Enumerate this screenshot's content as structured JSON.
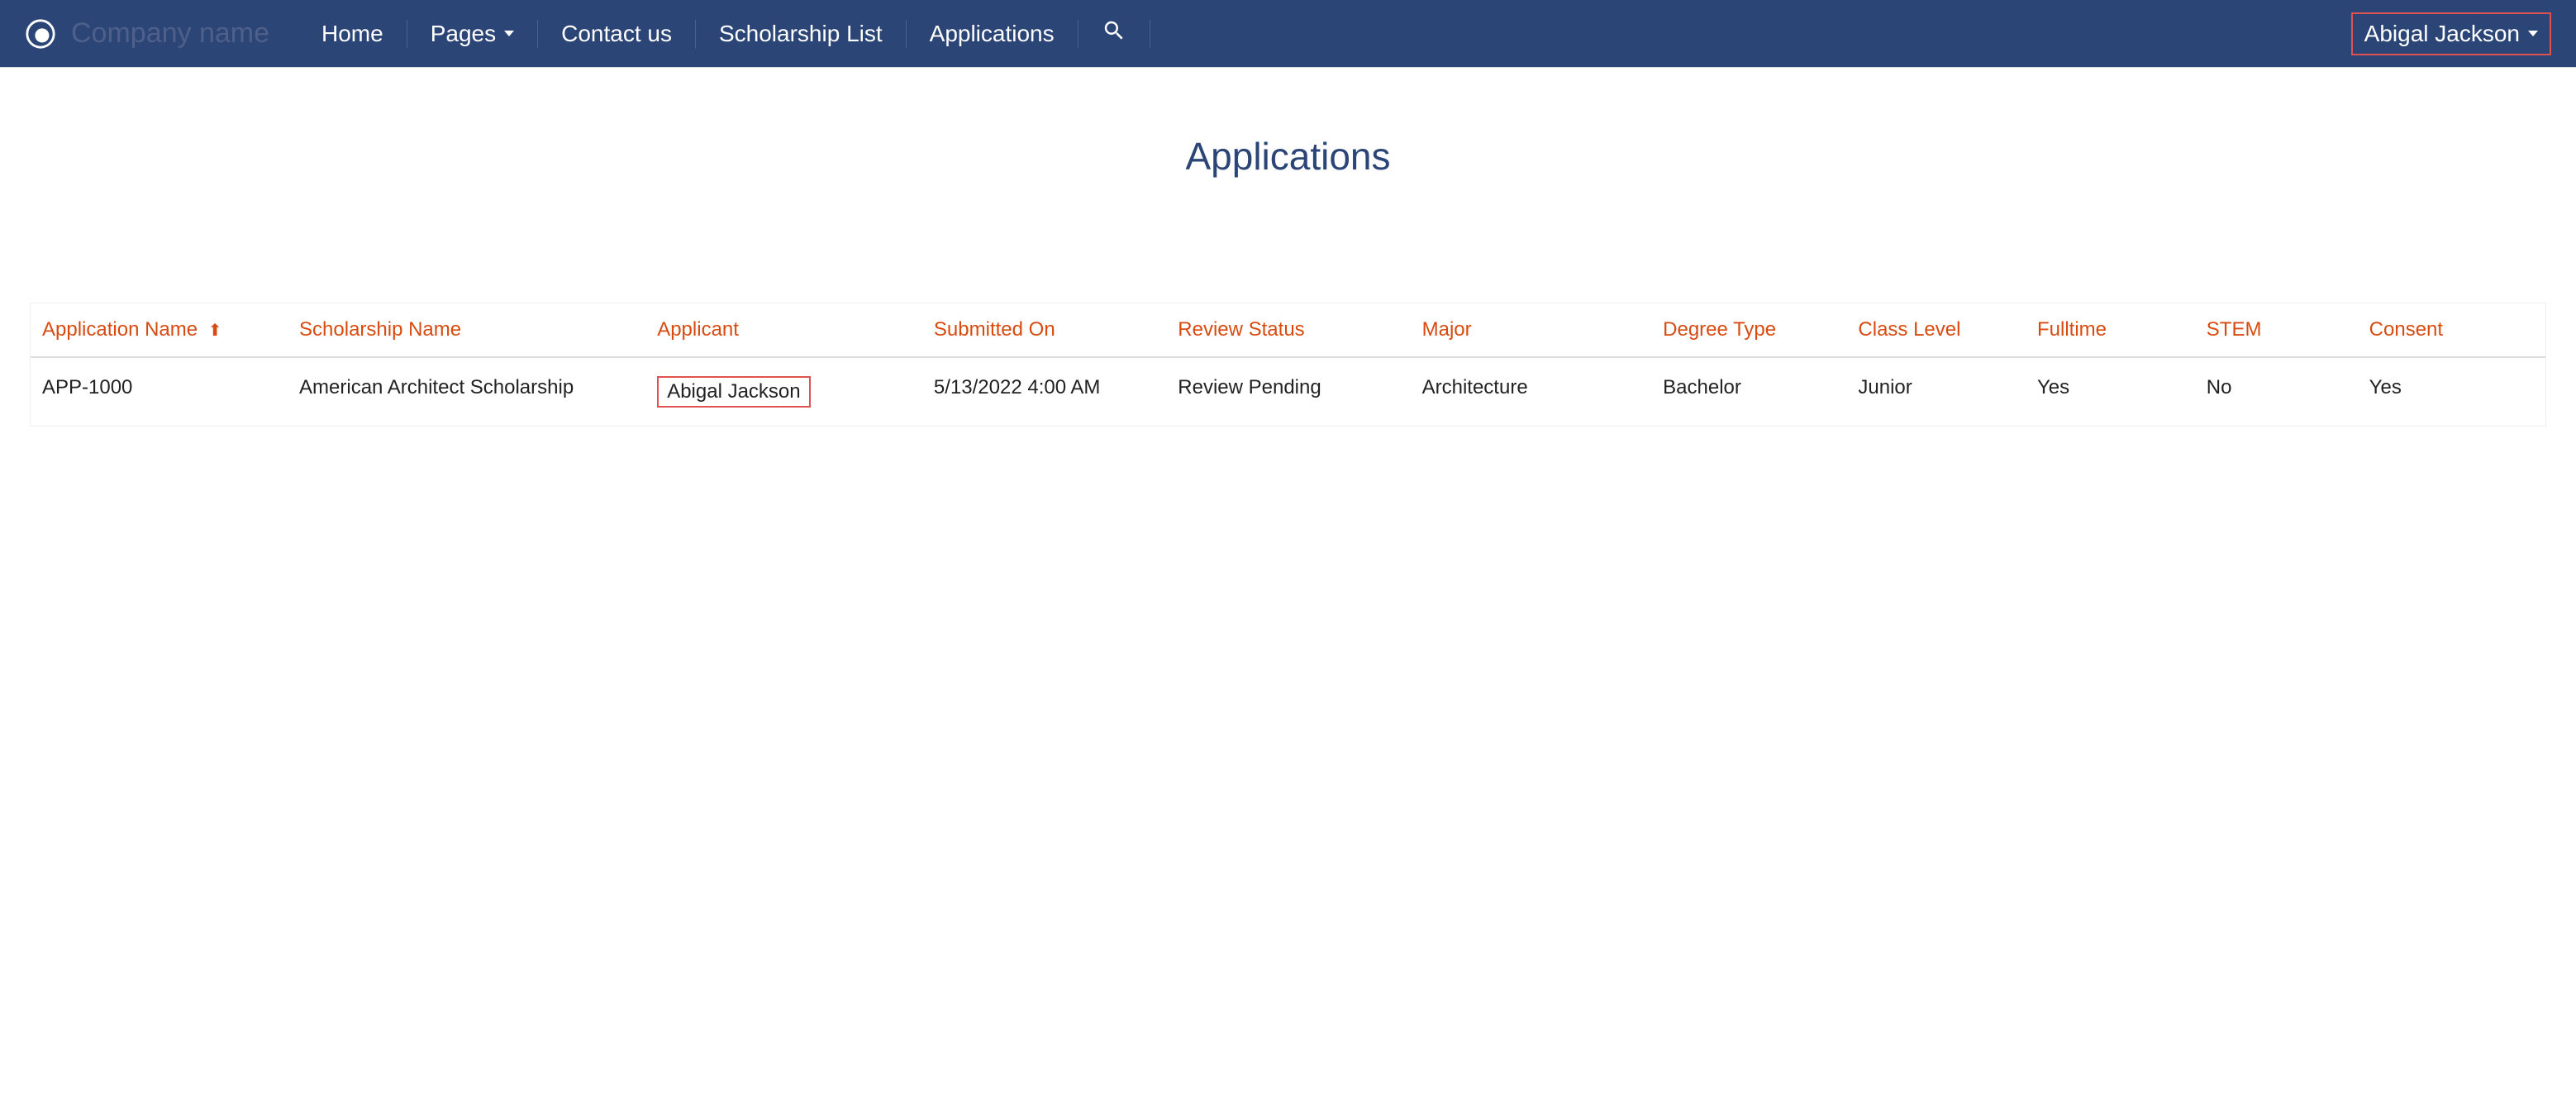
{
  "header": {
    "company_name": "Company name",
    "nav": {
      "home": "Home",
      "pages": "Pages",
      "contact": "Contact us",
      "scholarship_list": "Scholarship List",
      "applications": "Applications"
    },
    "user_name": "Abigal Jackson"
  },
  "page": {
    "title": "Applications"
  },
  "table": {
    "columns": {
      "application_name": "Application Name",
      "scholarship_name": "Scholarship Name",
      "applicant": "Applicant",
      "submitted_on": "Submitted On",
      "review_status": "Review Status",
      "major": "Major",
      "degree_type": "Degree Type",
      "class_level": "Class Level",
      "fulltime": "Fulltime",
      "stem": "STEM",
      "consent": "Consent"
    },
    "sort": {
      "column": "application_name",
      "direction": "asc"
    },
    "rows": [
      {
        "application_name": "APP-1000",
        "scholarship_name": "American Architect Scholarship",
        "applicant": "Abigal Jackson",
        "submitted_on": "5/13/2022 4:00 AM",
        "review_status": "Review Pending",
        "major": "Architecture",
        "degree_type": "Bachelor",
        "class_level": "Junior",
        "fulltime": "Yes",
        "stem": "No",
        "consent": "Yes"
      }
    ]
  }
}
